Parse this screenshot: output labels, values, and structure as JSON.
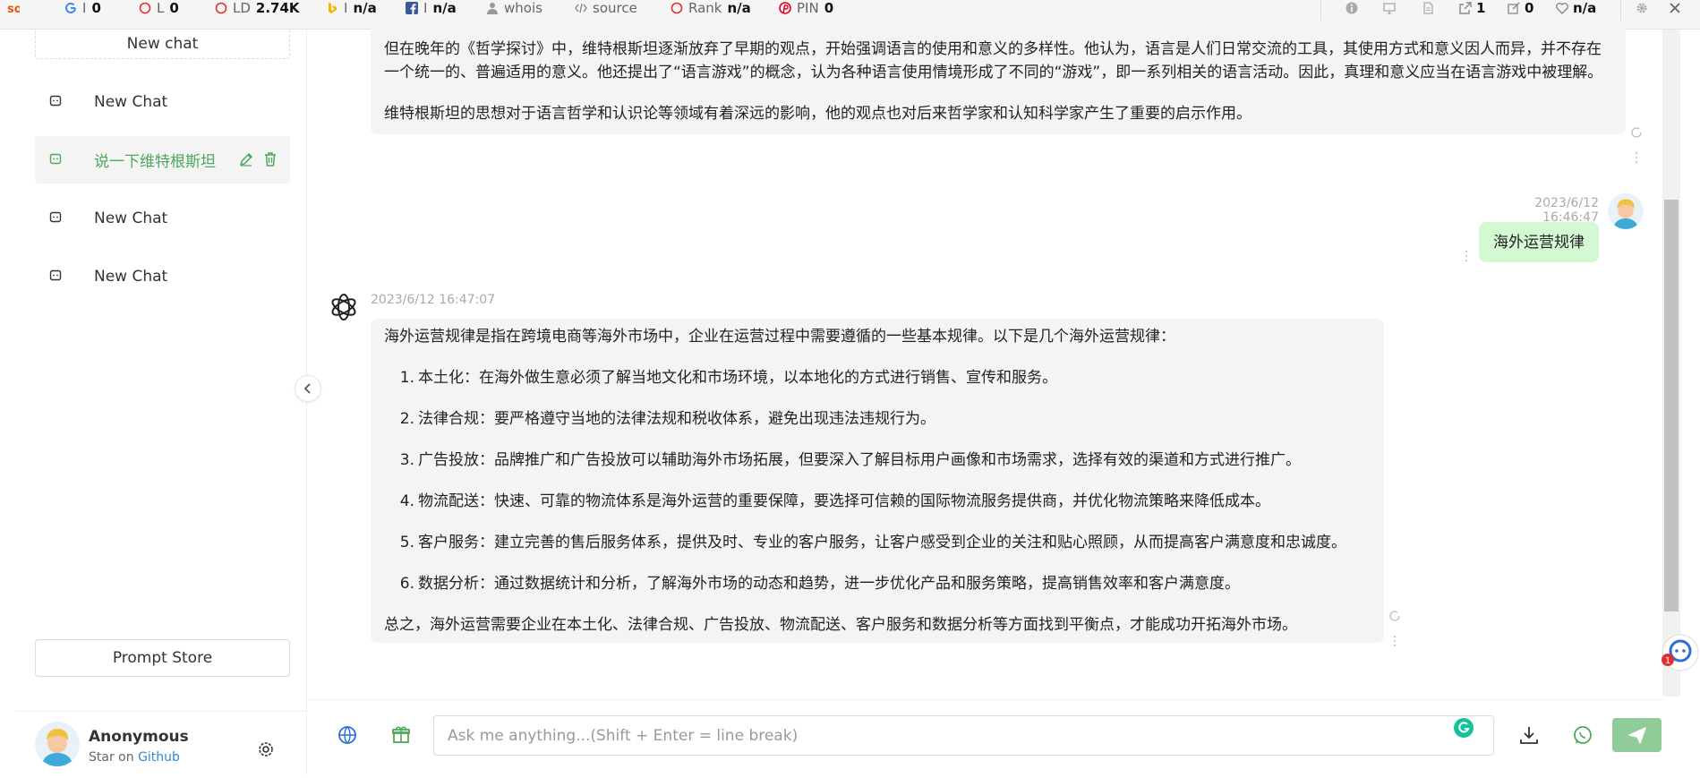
{
  "seobar": {
    "items": [
      {
        "icon": "google-icon",
        "label": "I",
        "value": "0"
      },
      {
        "icon": "circle-icon",
        "label": "L",
        "value": "0"
      },
      {
        "icon": "circle-icon",
        "label": "LD",
        "value": "2.74K"
      },
      {
        "icon": "bing-icon",
        "label": "I",
        "value": "n/a"
      },
      {
        "icon": "facebook-icon",
        "label": "I",
        "value": "n/a"
      },
      {
        "icon": "whois-icon",
        "label": "whois",
        "value": ""
      },
      {
        "icon": "code-icon",
        "label": "source",
        "value": ""
      },
      {
        "icon": "circle-icon",
        "label": "Rank",
        "value": "n/a"
      },
      {
        "icon": "pinterest-icon",
        "label": "PIN",
        "value": "0"
      }
    ],
    "right": {
      "external_links": "1",
      "internal_links": "0",
      "health": "n/a"
    }
  },
  "sidebar": {
    "new_chat_label": "New chat",
    "chats": [
      {
        "label": "New Chat"
      },
      {
        "label": "说一下维特根斯坦"
      },
      {
        "label": "New Chat"
      },
      {
        "label": "New Chat"
      }
    ],
    "prompt_store_label": "Prompt Store",
    "user": {
      "name": "Anonymous",
      "sub_prefix": "Star on",
      "sub_link": "Github"
    }
  },
  "messages": {
    "prev_reply": {
      "p1": "但在晚年的《哲学探讨》中，维特根斯坦逐渐放弃了早期的观点，开始强调语言的使用和意义的多样性。他认为，语言是人们日常交流的工具，其使用方式和意义因人而异，并不存在一个统一的、普遍适用的意义。他还提出了“语言游戏”的概念，认为各种语言使用情境形成了不同的“游戏”，即一系列相关的语言活动。因此，真理和意义应当在语言游戏中被理解。",
      "p2": "维特根斯坦的思想对于语言哲学和认识论等领域有着深远的影响，他的观点也对后来哲学家和认知科学家产生了重要的启示作用。"
    },
    "user_msg": {
      "time": "2023/6/12 16:46:47",
      "text": "海外运营规律"
    },
    "reply": {
      "time": "2023/6/12 16:47:07",
      "intro": "海外运营规律是指在跨境电商等海外市场中，企业在运营过程中需要遵循的一些基本规律。以下是几个海外运营规律：",
      "items": [
        {
          "n": "1.",
          "text": "本土化：在海外做生意必须了解当地文化和市场环境，以本地化的方式进行销售、宣传和服务。"
        },
        {
          "n": "2.",
          "text": "法律合规：要严格遵守当地的法律法规和税收体系，避免出现违法违规行为。"
        },
        {
          "n": "3.",
          "text": "广告投放：品牌推广和广告投放可以辅助海外市场拓展，但要深入了解目标用户画像和市场需求，选择有效的渠道和方式进行推广。"
        },
        {
          "n": "4.",
          "text": "物流配送：快速、可靠的物流体系是海外运营的重要保障，要选择可信赖的国际物流服务提供商，并优化物流策略来降低成本。"
        },
        {
          "n": "5.",
          "text": "客户服务：建立完善的售后服务体系，提供及时、专业的客户服务，让客户感受到企业的关注和贴心照顾，从而提高客户满意度和忠诚度。"
        },
        {
          "n": "6.",
          "text": "数据分析：通过数据统计和分析，了解海外市场的动态和趋势，进一步优化产品和服务策略，提高销售效率和客户满意度。"
        }
      ],
      "outro": "总之，海外运营需要企业在本土化、法律合规、广告投放、物流配送、客户服务和数据分析等方面找到平衡点，才能成功开拓海外市场。"
    }
  },
  "input": {
    "placeholder": "Ask me anything...(Shift + Enter = line break)"
  },
  "colors": {
    "accent": "#4ca85b",
    "send_bg": "#8fcc98",
    "user_bubble": "#d2f9d1"
  }
}
